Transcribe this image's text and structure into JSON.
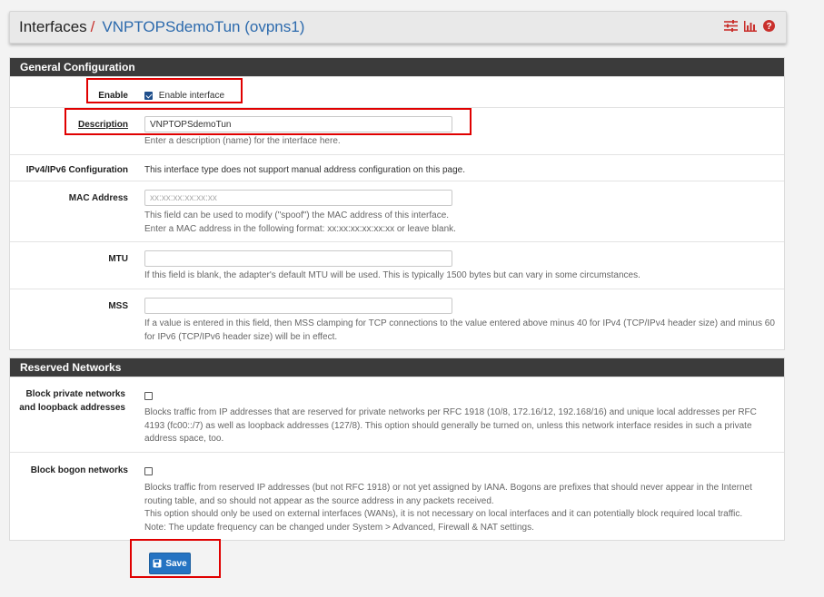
{
  "breadcrumb": {
    "root": "Interfaces",
    "separator": "/",
    "current": "VNPTOPSdemoTun (ovpns1)"
  },
  "header_icons": [
    "sliders-icon",
    "bar-chart-icon",
    "help-icon"
  ],
  "general": {
    "heading": "General Configuration",
    "enable": {
      "label": "Enable",
      "checkbox_label": "Enable interface",
      "checked": true
    },
    "description": {
      "label": "Description",
      "value": "VNPTOPSdemoTun",
      "help": "Enter a description (name) for the interface here."
    },
    "ipconfig": {
      "label": "IPv4/IPv6 Configuration",
      "text": "This interface type does not support manual address configuration on this page."
    },
    "mac": {
      "label": "MAC Address",
      "placeholder": "xx:xx:xx:xx:xx:xx",
      "help1": "This field can be used to modify (\"spoof\") the MAC address of this interface.",
      "help2": "Enter a MAC address in the following format: xx:xx:xx:xx:xx:xx or leave blank."
    },
    "mtu": {
      "label": "MTU",
      "help": "If this field is blank, the adapter's default MTU will be used. This is typically 1500 bytes but can vary in some circumstances."
    },
    "mss": {
      "label": "MSS",
      "help": "If a value is entered in this field, then MSS clamping for TCP connections to the value entered above minus 40 for IPv4 (TCP/IPv4 header size) and minus 60 for IPv6 (TCP/IPv6 header size) will be in effect."
    }
  },
  "reserved": {
    "heading": "Reserved Networks",
    "private": {
      "label": "Block private networks and loopback addresses",
      "checked": false,
      "help": "Blocks traffic from IP addresses that are reserved for private networks per RFC 1918 (10/8, 172.16/12, 192.168/16) and unique local addresses per RFC 4193 (fc00::/7) as well as loopback addresses (127/8). This option should generally be turned on, unless this network interface resides in such a private address space, too."
    },
    "bogon": {
      "label": "Block bogon networks",
      "checked": false,
      "help1": "Blocks traffic from reserved IP addresses (but not RFC 1918) or not yet assigned by IANA. Bogons are prefixes that should never appear in the Internet routing table, and so should not appear as the source address in any packets received.",
      "help2": "This option should only be used on external interfaces (WANs), it is not necessary on local interfaces and it can potentially block required local traffic.",
      "help3": "Note: The update frequency can be changed under System > Advanced, Firewall & NAT settings."
    }
  },
  "save_label": "Save",
  "colors": {
    "accent": "#2573c2",
    "highlight": "#e00000",
    "heading_bg": "#3b3b3b",
    "breadcrumb_link": "#2c6aad"
  }
}
